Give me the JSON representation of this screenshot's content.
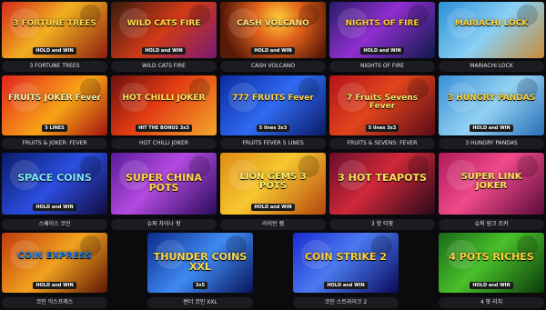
{
  "tiles": [
    {
      "label": "3 FORTUNE TREES",
      "logo": "3 FORTUNE TREES",
      "sub": "HOLD and WIN",
      "bg": "linear-gradient(135deg,#d42a1b 0%,#f0b020 45%,#8e1d10 100%)",
      "logoColor": "#ffd34a"
    },
    {
      "label": "WILD CATS FIRE",
      "logo": "WILD CATS FIRE",
      "sub": "HOLD and WIN",
      "bg": "linear-gradient(135deg,#3a1a0e 0%,#d13a18 50%,#7a1a72 100%)",
      "logoColor": "#ffe04a"
    },
    {
      "label": "CASH VOLCANO",
      "logo": "CASH VOLCANO",
      "sub": "HOLD and WIN",
      "bg": "radial-gradient(circle at 55% 30%,#ffcf3a 0%,#e0601a 35%,#5a1a08 80%)",
      "logoColor": "#ffe27a"
    },
    {
      "label": "NIGHTS OF FIRE",
      "logo": "NIGHTS OF FIRE",
      "sub": "HOLD and WIN",
      "bg": "linear-gradient(135deg,#2a1b6a 0%,#8f2fd0 45%,#0e1a4a 100%)",
      "logoColor": "#ffcc33"
    },
    {
      "label": "MARIACHI LOCK",
      "logo": "MARIACHI LOCK",
      "sub": "",
      "bg": "linear-gradient(135deg,#2b8fd6 0%,#8ad0f5 50%,#c98b36 100%)",
      "logoColor": "#ffd23a"
    },
    {
      "label": "FRUITS & JOKER: FEVER",
      "logo": "FRUITS JOKER Fever",
      "sub": "5 LINES",
      "bg": "linear-gradient(135deg,#e3231e 0%,#f7a316 55%,#a3130f 100%)",
      "logoColor": "#fff2a8"
    },
    {
      "label": "HOT CHILLI JOKER",
      "logo": "HOT CHILLI JOKER",
      "sub": "HIT THE BONUS 3x3",
      "bg": "linear-gradient(135deg,#6e0f0d 0%,#e33c13 45%,#f4a62a 100%)",
      "logoColor": "#ffe65a"
    },
    {
      "label": "FRUITS FEVER 5 LINES",
      "logo": "777 FRUITS Fever",
      "sub": "5 lines 3x3",
      "bg": "linear-gradient(135deg,#0b2ba3 0%,#2f6af0 50%,#0a1a66 100%)",
      "logoColor": "#ffd84a"
    },
    {
      "label": "FRUITS & SEVENS: FEVER",
      "logo": "7 Fruits Sevens Fever",
      "sub": "5 lines 3x3",
      "bg": "linear-gradient(135deg,#b5121a 0%,#e0451c 45%,#5b0a18 100%)",
      "logoColor": "#ffe36a"
    },
    {
      "label": "3 HUNGRY PANDAS",
      "logo": "3 HUNGRY PANDAS",
      "sub": "HOLD and WIN",
      "bg": "linear-gradient(135deg,#3a8fd8 0%,#93d1f2 50%,#2a6fb8 100%)",
      "logoColor": "#ffd43a"
    },
    {
      "label": "스페이스 코인",
      "logo": "SPACE COINS",
      "sub": "HOLD and WIN",
      "bg": "linear-gradient(135deg,#0a1a6a 0%,#2b4ee0 50%,#120c40 100%)",
      "logoColor": "#7ee6ff"
    },
    {
      "label": "슈퍼 차이나 팟",
      "logo": "SUPER CHINA POTS",
      "sub": "",
      "bg": "linear-gradient(135deg,#5a1a9a 0%,#b44ae0 45%,#2a0c5a 100%)",
      "logoColor": "#ffd84a"
    },
    {
      "label": "라이언 젬",
      "logo": "LION GEMS 3 POTS",
      "sub": "HOLD and WIN",
      "bg": "linear-gradient(135deg,#e08a16 0%,#f6c72f 45%,#b4440e 100%)",
      "logoColor": "#fff06a"
    },
    {
      "label": "3 핫 티팟",
      "logo": "3 HOT TEAPOTS",
      "sub": "",
      "bg": "linear-gradient(135deg,#6a0c2a 0%,#d0283a 45%,#2a0a1a 100%)",
      "logoColor": "#ffe05a"
    },
    {
      "label": "슈퍼 링크 조커",
      "logo": "SUPER LINK JOKER",
      "sub": "",
      "bg": "linear-gradient(135deg,#b01a5a 0%,#f04a8a 45%,#5a0a3a 100%)",
      "logoColor": "#ffe45a"
    },
    {
      "label": "코인 익스프레스",
      "logo": "COIN EXPRESS",
      "sub": "HOLD and WIN",
      "bg": "linear-gradient(135deg,#c0390e 0%,#f1a21e 50%,#5e1505 100%)",
      "logoColor": "#2a7fe0"
    },
    {
      "label": "썬더 코인 XXL",
      "logo": "THUNDER COINS XXL",
      "sub": "3x5",
      "bg": "linear-gradient(135deg,#0b2a8a 0%,#3f8af2 50%,#08155a 100%)",
      "logoColor": "#ffd84a"
    },
    {
      "label": "코인 스트라이크 2",
      "logo": "COIN STRIKE 2",
      "sub": "HOLD and WIN",
      "bg": "linear-gradient(135deg,#1a2ad0 0%,#4a7af0 45%,#0a0a5a 100%)",
      "logoColor": "#ffd23a"
    },
    {
      "label": "4 팟 리치",
      "logo": "4 POTS RICHES",
      "sub": "HOLD and WIN",
      "bg": "linear-gradient(135deg,#1a6a1a 0%,#4ac02a 45%,#0a3a0a 100%)",
      "logoColor": "#ffd43a"
    }
  ]
}
